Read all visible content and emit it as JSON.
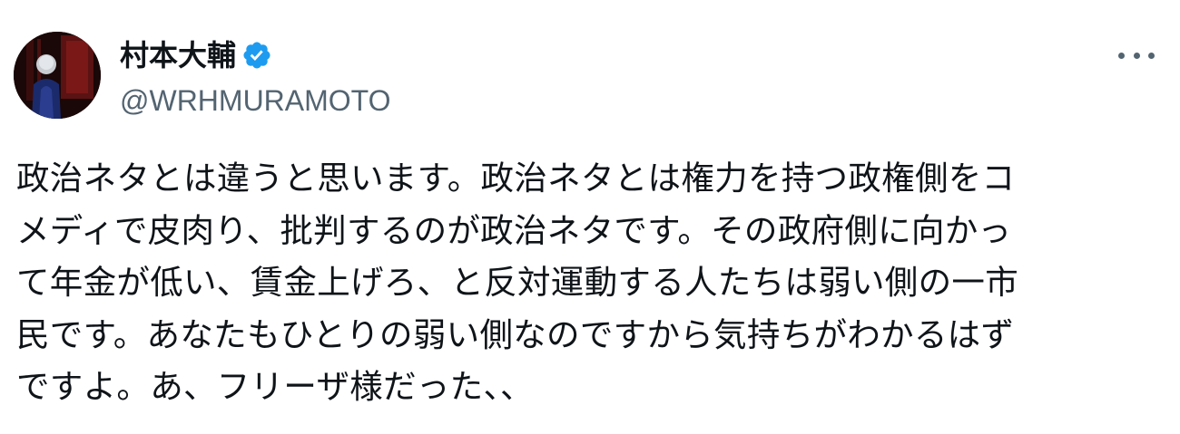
{
  "author": {
    "display_name": "村本大輔",
    "handle": "@WRHMURAMOTO",
    "verified": true,
    "avatar_icon": "avatar-photo",
    "verified_color": "#1d9bf0"
  },
  "menu": {
    "icon": "more-icon"
  },
  "tweet": {
    "lines": [
      "政治ネタとは違うと思います。政治ネタとは権力を持つ政権側をコ",
      "メディで皮肉り、批判するのが政治ネタです。その政府側に向かっ",
      "て年金が低い、賃金上げろ、と反対運動する人たちは弱い側の一市",
      "民です。あなたもひとりの弱い側なのですから気持ちがわかるはず",
      "ですよ。あ、フリーザ様だった、、"
    ]
  }
}
